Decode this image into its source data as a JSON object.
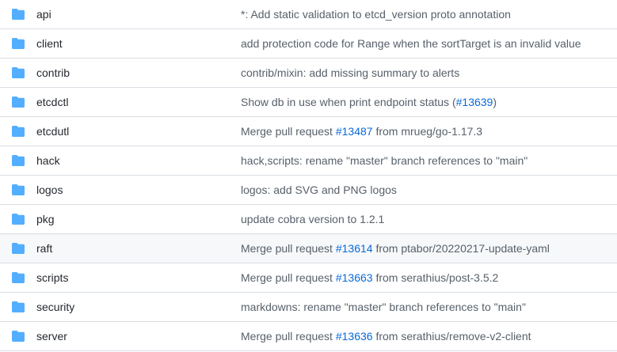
{
  "colors": {
    "folder_icon": "#54aeff",
    "link": "#0969da",
    "text_primary": "#24292f",
    "text_secondary": "#57606a",
    "row_border": "#d8dee4",
    "row_highlight": "#f6f8fa"
  },
  "rows": [
    {
      "icon": "folder-icon",
      "name": "api",
      "message": [
        {
          "text": "*: Add static validation to etcd_version proto annotation"
        }
      ]
    },
    {
      "icon": "folder-icon",
      "name": "client",
      "message": [
        {
          "text": "add protection code for Range when the sortTarget is an invalid value"
        }
      ]
    },
    {
      "icon": "folder-icon",
      "name": "contrib",
      "message": [
        {
          "text": "contrib/mixin: add missing summary to alerts"
        }
      ]
    },
    {
      "icon": "folder-icon",
      "name": "etcdctl",
      "message": [
        {
          "text": "Show db in use when print endpoint status ("
        },
        {
          "text": "#13639",
          "link": true
        },
        {
          "text": ")"
        }
      ]
    },
    {
      "icon": "folder-icon",
      "name": "etcdutl",
      "message": [
        {
          "text": "Merge pull request "
        },
        {
          "text": "#13487",
          "link": true
        },
        {
          "text": " from mrueg/go-1.17.3"
        }
      ]
    },
    {
      "icon": "folder-icon",
      "name": "hack",
      "message": [
        {
          "text": "hack,scripts: rename \"master\" branch references to \"main\""
        }
      ]
    },
    {
      "icon": "folder-icon",
      "name": "logos",
      "message": [
        {
          "text": "logos: add SVG and PNG logos"
        }
      ]
    },
    {
      "icon": "folder-icon",
      "name": "pkg",
      "message": [
        {
          "text": "update cobra version to 1.2.1"
        }
      ]
    },
    {
      "icon": "folder-icon",
      "name": "raft",
      "highlighted": true,
      "message": [
        {
          "text": "Merge pull request "
        },
        {
          "text": "#13614",
          "link": true
        },
        {
          "text": " from ptabor/20220217-update-yaml"
        }
      ]
    },
    {
      "icon": "folder-icon",
      "name": "scripts",
      "message": [
        {
          "text": "Merge pull request "
        },
        {
          "text": "#13663",
          "link": true
        },
        {
          "text": " from serathius/post-3.5.2"
        }
      ]
    },
    {
      "icon": "folder-icon",
      "name": "security",
      "message": [
        {
          "text": "markdowns: rename \"master\" branch references to \"main\""
        }
      ]
    },
    {
      "icon": "folder-icon",
      "name": "server",
      "message": [
        {
          "text": "Merge pull request "
        },
        {
          "text": "#13636",
          "link": true
        },
        {
          "text": " from serathius/remove-v2-client"
        }
      ]
    }
  ]
}
